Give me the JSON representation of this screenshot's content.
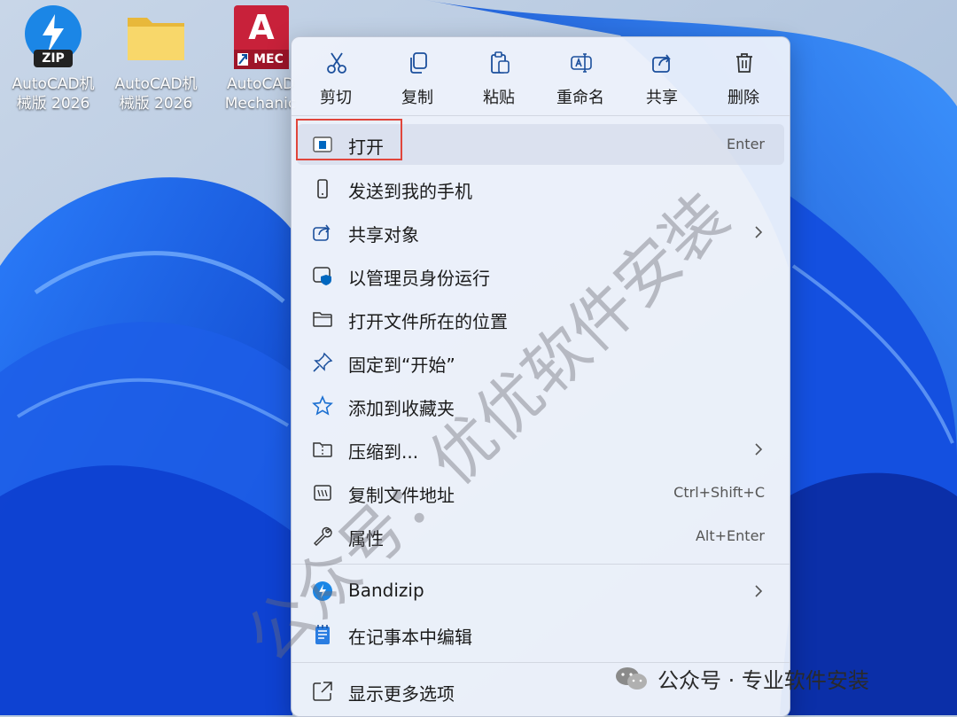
{
  "desktop": {
    "icons": [
      {
        "line1": "AutoCAD机",
        "line2": "械版 2026",
        "badge": "ZIP",
        "icon": "bandizip-archive-icon"
      },
      {
        "line1": "AutoCAD机",
        "line2": "械版 2026",
        "icon": "folder-icon"
      },
      {
        "line1": "AutoCAD",
        "line2": "Mechanic",
        "badge": "MEC",
        "letter": "A",
        "icon": "autocad-mechanical-icon"
      }
    ]
  },
  "toolbar": {
    "cut": "剪切",
    "copy": "复制",
    "paste": "粘贴",
    "rename": "重命名",
    "share": "共享",
    "delete": "删除"
  },
  "menu": {
    "open": {
      "label": "打开",
      "shortcut": "Enter"
    },
    "send_to_phone": {
      "label": "发送到我的手机"
    },
    "share_with": {
      "label": "共享对象"
    },
    "run_as_admin": {
      "label": "以管理员身份运行"
    },
    "open_location": {
      "label": "打开文件所在的位置"
    },
    "pin_start": {
      "label": "固定到“开始”"
    },
    "add_favorites": {
      "label": "添加到收藏夹"
    },
    "compress_to": {
      "label": "压缩到..."
    },
    "copy_path": {
      "label": "复制文件地址",
      "shortcut": "Ctrl+Shift+C"
    },
    "properties": {
      "label": "属性",
      "shortcut": "Alt+Enter"
    },
    "bandizip": {
      "label": "Bandizip"
    },
    "edit_notepad": {
      "label": "在记事本中编辑"
    },
    "more_options": {
      "label": "显示更多选项"
    }
  },
  "watermark": {
    "diagonal": "公众号：优优软件安装",
    "footer": "公众号 · 专业软件安装"
  },
  "colors": {
    "accent": "#0067c0",
    "highlight_border": "#e0453b",
    "menu_bg": "#eef2fb"
  }
}
